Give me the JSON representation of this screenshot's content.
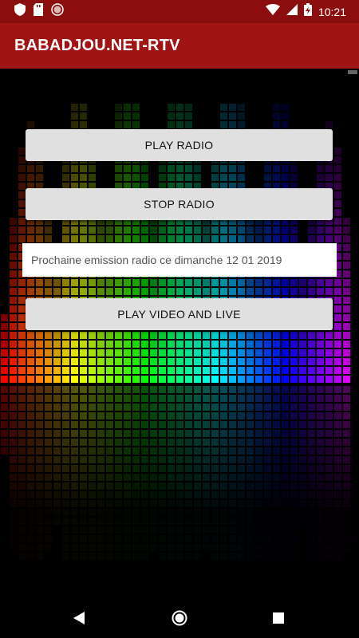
{
  "status_bar": {
    "time": "10:21",
    "icons": [
      "shield-icon",
      "sd-card-icon",
      "record-icon",
      "wifi-icon",
      "signal-icon",
      "battery-charging-icon"
    ]
  },
  "app_bar": {
    "title": "BABADJOU.NET-RTV"
  },
  "main": {
    "play_radio_label": "PLAY RADIO",
    "stop_radio_label": "STOP RADIO",
    "info_text": "Prochaine emission radio ce dimanche 12 01 2019",
    "play_video_label": "PLAY VIDEO AND LIVE"
  },
  "nav_bar": {
    "icons": [
      "back-icon",
      "home-icon",
      "recents-icon"
    ]
  },
  "colors": {
    "status_bar": "#8c0d0d",
    "app_bar": "#a11414",
    "button_bg": "#e0e0e0",
    "background": "#000000"
  }
}
